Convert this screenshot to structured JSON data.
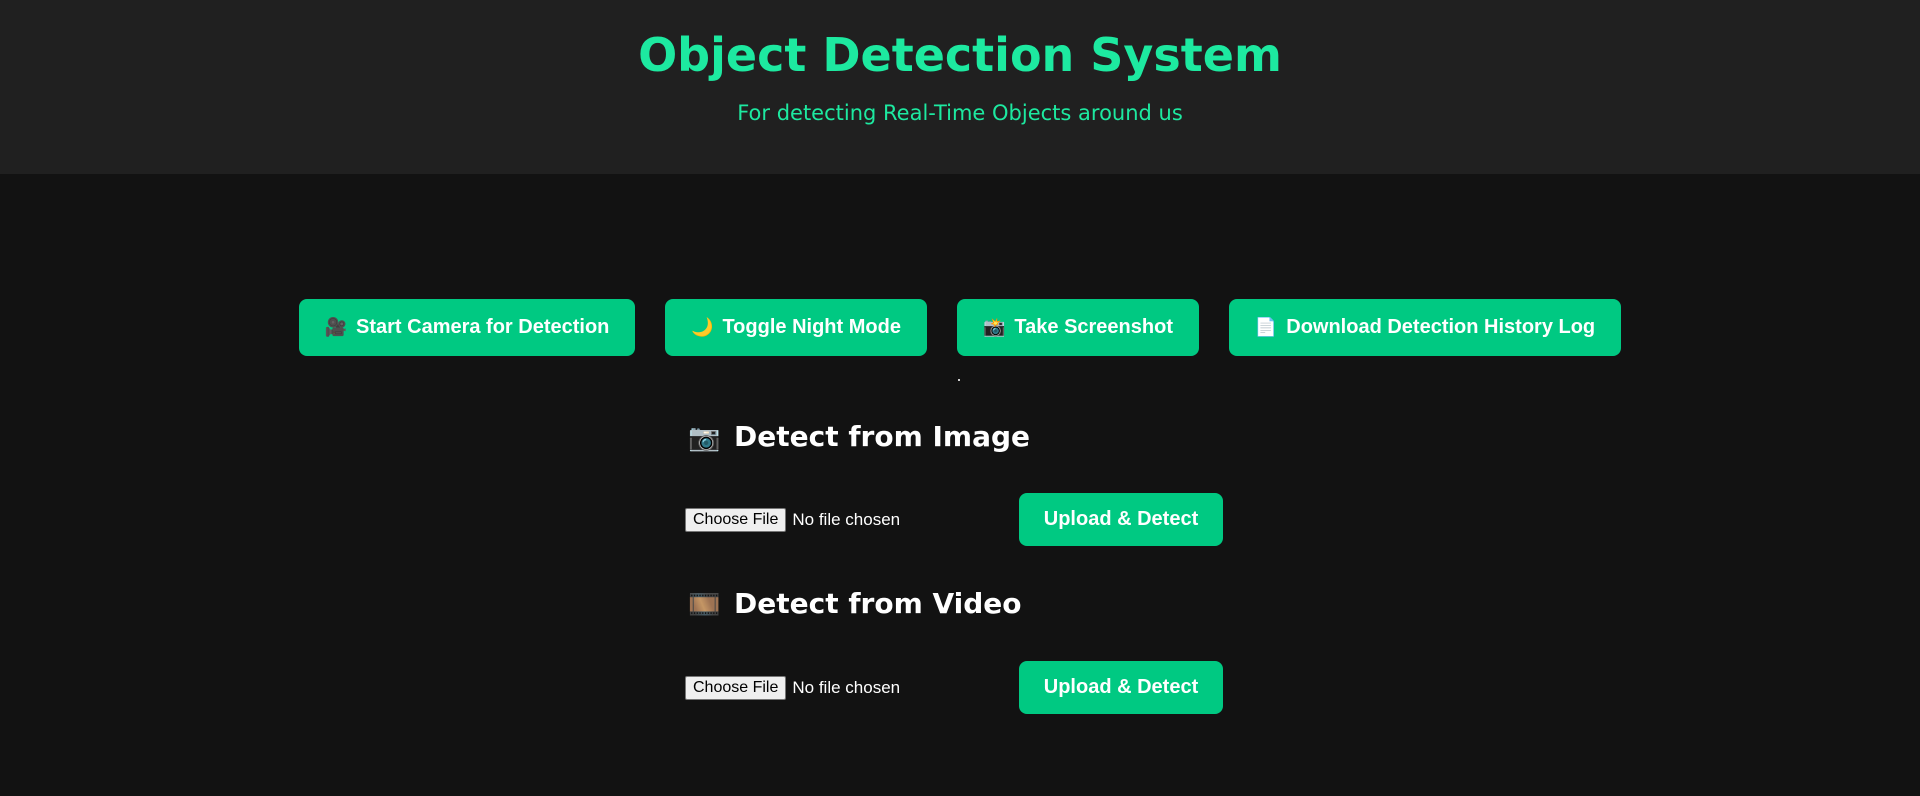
{
  "header": {
    "title": "Object Detection System",
    "subtitle": "For detecting Real-Time Objects around us"
  },
  "actions": [
    {
      "icon": "🎥",
      "icon_name": "video-camera-icon",
      "label": "Start Camera for Detection"
    },
    {
      "icon": "🌙",
      "icon_name": "crescent-moon-icon",
      "label": "Toggle Night Mode"
    },
    {
      "icon": "📸",
      "icon_name": "camera-flash-icon",
      "label": "Take Screenshot"
    },
    {
      "icon": "📄",
      "icon_name": "document-icon",
      "label": "Download Detection History Log"
    }
  ],
  "image_section": {
    "icon": "📷",
    "icon_name": "camera-icon",
    "title": "Detect from Image",
    "choose_label": "Choose File",
    "file_status": "No file chosen",
    "upload_label": "Upload & Detect"
  },
  "video_section": {
    "icon": "🎞️",
    "icon_name": "film-frames-icon",
    "title": "Detect from Video",
    "choose_label": "Choose File",
    "file_status": "No file chosen",
    "upload_label": "Upload & Detect"
  },
  "colors": {
    "accent": "#1de9a0",
    "button": "#00c982",
    "page_background": "#121212",
    "header_background": "#202020"
  }
}
